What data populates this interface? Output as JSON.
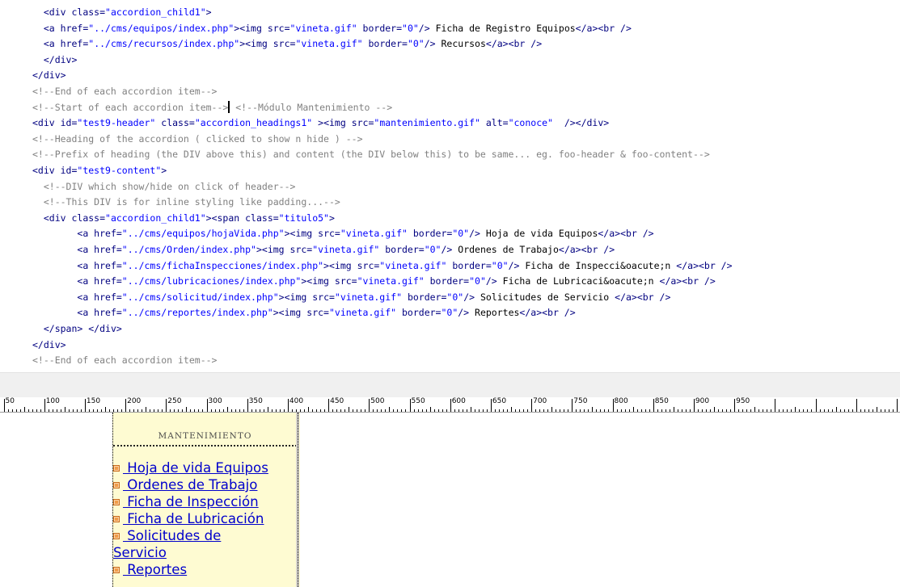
{
  "code_view": {
    "lines": [
      {
        "indent": "  ",
        "tokens": [
          [
            "tag",
            "<div "
          ],
          [
            "attr",
            "class="
          ],
          [
            "str",
            "\"accordion_child1\""
          ],
          [
            "tag",
            ">"
          ]
        ]
      },
      {
        "indent": "  ",
        "tokens": [
          [
            "tag",
            "<a "
          ],
          [
            "attr",
            "href="
          ],
          [
            "str",
            "\"../cms/equipos/index.php\""
          ],
          [
            "tag",
            "><img "
          ],
          [
            "attr",
            "src="
          ],
          [
            "str",
            "\"vineta.gif\""
          ],
          [
            "attr",
            " border="
          ],
          [
            "str",
            "\"0\""
          ],
          [
            "tag",
            "/>"
          ],
          [
            "txt",
            " Ficha de Registro Equipos"
          ],
          [
            "tag",
            "</a><br />"
          ]
        ]
      },
      {
        "indent": "  ",
        "tokens": [
          [
            "tag",
            "<a "
          ],
          [
            "attr",
            "href="
          ],
          [
            "str",
            "\"../cms/recursos/index.php\""
          ],
          [
            "tag",
            "><img "
          ],
          [
            "attr",
            "src="
          ],
          [
            "str",
            "\"vineta.gif\""
          ],
          [
            "attr",
            " border="
          ],
          [
            "str",
            "\"0\""
          ],
          [
            "tag",
            "/>"
          ],
          [
            "txt",
            " Recursos"
          ],
          [
            "tag",
            "</a><br />"
          ]
        ]
      },
      {
        "indent": "  ",
        "tokens": [
          [
            "tag",
            "</div>"
          ]
        ]
      },
      {
        "indent": "",
        "tokens": [
          [
            "tag",
            "</div>"
          ]
        ]
      },
      {
        "indent": "",
        "tokens": [
          [
            "com",
            "<!--End of each accordion item-->"
          ]
        ]
      },
      {
        "indent": "",
        "tokens": [
          [
            "com",
            "<!--Start of each accordion item-->"
          ],
          [
            "caret",
            ""
          ],
          [
            "com",
            " <!--Módulo Mantenimiento -->"
          ]
        ]
      },
      {
        "indent": "",
        "tokens": [
          [
            "tag",
            "<div "
          ],
          [
            "attr",
            "id="
          ],
          [
            "str",
            "\"test9-header\""
          ],
          [
            "attr",
            " class="
          ],
          [
            "str",
            "\"accordion_headings1\""
          ],
          [
            "tag",
            " ><img "
          ],
          [
            "attr",
            "src="
          ],
          [
            "str",
            "\"mantenimiento.gif\""
          ],
          [
            "attr",
            " alt="
          ],
          [
            "str",
            "\"conoce\""
          ],
          [
            "tag",
            "  /></div>"
          ]
        ]
      },
      {
        "indent": "",
        "tokens": [
          [
            "com",
            "<!--Heading of the accordion ( clicked to show n hide ) -->"
          ]
        ]
      },
      {
        "indent": "",
        "tokens": [
          [
            "com",
            "<!--Prefix of heading (the DIV above this) and content (the DIV below this) to be same... eg. foo-header & foo-content-->"
          ]
        ]
      },
      {
        "indent": "",
        "tokens": [
          [
            "tag",
            "<div "
          ],
          [
            "attr",
            "id="
          ],
          [
            "str",
            "\"test9-content\""
          ],
          [
            "tag",
            ">"
          ]
        ]
      },
      {
        "indent": "  ",
        "tokens": [
          [
            "com",
            "<!--DIV which show/hide on click of header-->"
          ]
        ]
      },
      {
        "indent": "  ",
        "tokens": [
          [
            "com",
            "<!--This DIV is for inline styling like padding...-->"
          ]
        ]
      },
      {
        "indent": "  ",
        "tokens": [
          [
            "tag",
            "<div "
          ],
          [
            "attr",
            "class="
          ],
          [
            "str",
            "\"accordion_child1\""
          ],
          [
            "tag",
            "><span "
          ],
          [
            "attr",
            "class="
          ],
          [
            "str",
            "\"titulo5\""
          ],
          [
            "tag",
            ">"
          ]
        ]
      },
      {
        "indent": "        ",
        "tokens": [
          [
            "tag",
            "<a "
          ],
          [
            "attr",
            "href="
          ],
          [
            "str",
            "\"../cms/equipos/hojaVida.php\""
          ],
          [
            "tag",
            "><img "
          ],
          [
            "attr",
            "src="
          ],
          [
            "str",
            "\"vineta.gif\""
          ],
          [
            "attr",
            " border="
          ],
          [
            "str",
            "\"0\""
          ],
          [
            "tag",
            "/>"
          ],
          [
            "txt",
            " Hoja de vida Equipos"
          ],
          [
            "tag",
            "</a><br />"
          ]
        ]
      },
      {
        "indent": "        ",
        "tokens": [
          [
            "tag",
            "<a "
          ],
          [
            "attr",
            "href="
          ],
          [
            "str",
            "\"../cms/Orden/index.php\""
          ],
          [
            "tag",
            "><img "
          ],
          [
            "attr",
            "src="
          ],
          [
            "str",
            "\"vineta.gif\""
          ],
          [
            "attr",
            " border="
          ],
          [
            "str",
            "\"0\""
          ],
          [
            "tag",
            "/>"
          ],
          [
            "txt",
            " Ordenes de Trabajo"
          ],
          [
            "tag",
            "</a><br />"
          ]
        ]
      },
      {
        "indent": "        ",
        "tokens": [
          [
            "tag",
            "<a "
          ],
          [
            "attr",
            "href="
          ],
          [
            "str",
            "\"../cms/fichaInspecciones/index.php\""
          ],
          [
            "tag",
            "><img "
          ],
          [
            "attr",
            "src="
          ],
          [
            "str",
            "\"vineta.gif\""
          ],
          [
            "attr",
            " border="
          ],
          [
            "str",
            "\"0\""
          ],
          [
            "tag",
            "/>"
          ],
          [
            "txt",
            " Ficha de Inspecci&oacute;n "
          ],
          [
            "tag",
            "</a><br />"
          ]
        ]
      },
      {
        "indent": "        ",
        "tokens": [
          [
            "tag",
            "<a "
          ],
          [
            "attr",
            "href="
          ],
          [
            "str",
            "\"../cms/lubricaciones/index.php\""
          ],
          [
            "tag",
            "><img "
          ],
          [
            "attr",
            "src="
          ],
          [
            "str",
            "\"vineta.gif\""
          ],
          [
            "attr",
            " border="
          ],
          [
            "str",
            "\"0\""
          ],
          [
            "tag",
            "/>"
          ],
          [
            "txt",
            " Ficha de Lubricaci&oacute;n "
          ],
          [
            "tag",
            "</a><br />"
          ]
        ]
      },
      {
        "indent": "        ",
        "tokens": [
          [
            "tag",
            "<a "
          ],
          [
            "attr",
            "href="
          ],
          [
            "str",
            "\"../cms/solicitud/index.php\""
          ],
          [
            "tag",
            "><img "
          ],
          [
            "attr",
            "src="
          ],
          [
            "str",
            "\"vineta.gif\""
          ],
          [
            "attr",
            " border="
          ],
          [
            "str",
            "\"0\""
          ],
          [
            "tag",
            "/>"
          ],
          [
            "txt",
            " Solicitudes de Servicio "
          ],
          [
            "tag",
            "</a><br />"
          ]
        ]
      },
      {
        "indent": "        ",
        "tokens": [
          [
            "tag",
            "<a "
          ],
          [
            "attr",
            "href="
          ],
          [
            "str",
            "\"../cms/reportes/index.php\""
          ],
          [
            "tag",
            "><img "
          ],
          [
            "attr",
            "src="
          ],
          [
            "str",
            "\"vineta.gif\""
          ],
          [
            "attr",
            " border="
          ],
          [
            "str",
            "\"0\""
          ],
          [
            "tag",
            "/>"
          ],
          [
            "txt",
            " Reportes"
          ],
          [
            "tag",
            "</a><br />"
          ]
        ]
      },
      {
        "indent": "  ",
        "tokens": [
          [
            "tag",
            "</span> </div>"
          ]
        ]
      },
      {
        "indent": "",
        "tokens": [
          [
            "tag",
            "</div>"
          ]
        ]
      },
      {
        "indent": "",
        "tokens": [
          [
            "com",
            "<!--End of each accordion item-->"
          ]
        ]
      }
    ]
  },
  "ruler": {
    "labels": [
      "50",
      "100",
      "150",
      "200",
      "250",
      "300",
      "350",
      "400",
      "450",
      "500",
      "550",
      "600",
      "650",
      "700",
      "750",
      "800",
      "850",
      "900",
      "950"
    ]
  },
  "design_view": {
    "header_label": "MANTENIMIENTO",
    "links": [
      {
        "label": " Hoja de vida Equipos",
        "icon": "bullet-icon"
      },
      {
        "label": " Ordenes de Trabajo",
        "icon": "bullet-icon"
      },
      {
        "label": " Ficha de Inspección",
        "icon": "bullet-icon"
      },
      {
        "label": " Ficha de Lubricación",
        "icon": "bullet-icon"
      },
      {
        "label": " Solicitudes de Servicio",
        "icon": "bullet-icon"
      },
      {
        "label": " Reportes",
        "icon": "bullet-icon"
      }
    ],
    "colors": {
      "panel_bg": "#fefbd2",
      "link": "#0000cc",
      "bullet": "#f09c4a",
      "tag": "#000080",
      "string": "#0000ff",
      "comment": "#808080"
    }
  }
}
